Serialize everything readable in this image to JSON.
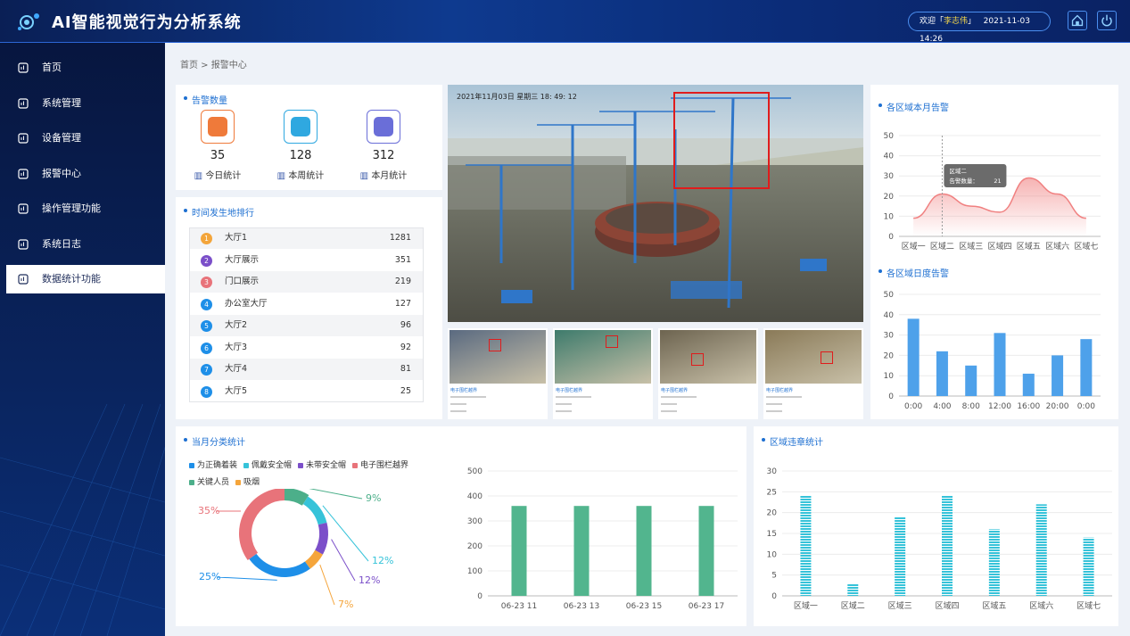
{
  "app": {
    "title": "AI智能视觉行为分析系统",
    "welcome_prefix": "欢迎「",
    "user": "李志伟",
    "welcome_suffix": "」",
    "datetime": "2021-11-03  14:26"
  },
  "nav": {
    "items": [
      {
        "label": "首页",
        "icon": "home-icon"
      },
      {
        "label": "系统管理",
        "icon": "gear-icon"
      },
      {
        "label": "设备管理",
        "icon": "org-icon"
      },
      {
        "label": "报警中心",
        "icon": "alarm-icon"
      },
      {
        "label": "操作管理功能",
        "icon": "cube-icon"
      },
      {
        "label": "系统日志",
        "icon": "log-icon"
      },
      {
        "label": "数据统计功能",
        "icon": "chart-icon"
      }
    ],
    "active_index": 6
  },
  "breadcrumb": "首页 > 报警中心",
  "alarm_count": {
    "title": "告警数量",
    "items": [
      {
        "value": "35",
        "label": "今日统计",
        "color": "#ef7a3a"
      },
      {
        "value": "128",
        "label": "本周统计",
        "color": "#2fa8e0"
      },
      {
        "value": "312",
        "label": "本月统计",
        "color": "#6a6ed8"
      }
    ]
  },
  "ranking": {
    "title": "时间发生地排行",
    "rows": [
      {
        "rank": "1",
        "name": "大厅1",
        "value": "1281",
        "color": "#f3a53b"
      },
      {
        "rank": "2",
        "name": "大厅展示",
        "value": "351",
        "color": "#7b4fc9"
      },
      {
        "rank": "3",
        "name": "门口展示",
        "value": "219",
        "color": "#e8737a"
      },
      {
        "rank": "4",
        "name": "办公室大厅",
        "value": "127",
        "color": "#1e8fe8"
      },
      {
        "rank": "5",
        "name": "大厅2",
        "value": "96",
        "color": "#1e8fe8"
      },
      {
        "rank": "6",
        "name": "大厅3",
        "value": "92",
        "color": "#1e8fe8"
      },
      {
        "rank": "7",
        "name": "大厅4",
        "value": "81",
        "color": "#1e8fe8"
      },
      {
        "rank": "8",
        "name": "大厅5",
        "value": "25",
        "color": "#1e8fe8"
      }
    ]
  },
  "camera": {
    "timestamp": "2021年11月03日   星期三   18: 49: 12"
  },
  "thumbs": [
    {
      "caption": "电子围栏越界"
    },
    {
      "caption": "电子围栏越界"
    },
    {
      "caption": "电子围栏越界"
    },
    {
      "caption": "电子围栏越界"
    }
  ],
  "monthly_region": {
    "title": "各区域本月告警",
    "tooltip_title": "区域二",
    "tooltip_label": "告警数量：",
    "tooltip_value": "21"
  },
  "daily_region": {
    "title": "各区域日度告警"
  },
  "category": {
    "title": "当月分类统计",
    "legend": [
      {
        "label": "为正确着装",
        "color": "#1e8fe8"
      },
      {
        "label": "佩戴安全帽",
        "color": "#36c3d9"
      },
      {
        "label": "未带安全帽",
        "color": "#7b4fc9"
      },
      {
        "label": "电子围栏越界",
        "color": "#e8737a"
      },
      {
        "label": "关键人员",
        "color": "#4caf8a"
      },
      {
        "label": "吸烟",
        "color": "#f5a53b"
      }
    ]
  },
  "violation": {
    "title": "区域违章统计"
  },
  "chart_data": [
    {
      "type": "area",
      "categories": [
        "区域一",
        "区域二",
        "区域三",
        "区域四",
        "区域五",
        "区域六",
        "区域七"
      ],
      "values": [
        9,
        21,
        15,
        12,
        29,
        21,
        9
      ],
      "ylim": [
        0,
        50
      ],
      "yticks": [
        0,
        10,
        20,
        30,
        40,
        50
      ],
      "color": "#f08080",
      "grid": true
    },
    {
      "type": "bar",
      "categories": [
        "0:00",
        "4:00",
        "8:00",
        "12:00",
        "16:00",
        "20:00",
        "0:00"
      ],
      "values": [
        38,
        22,
        15,
        31,
        11,
        20,
        28
      ],
      "ylim": [
        0,
        50
      ],
      "yticks": [
        0,
        10,
        20,
        30,
        40,
        50
      ],
      "color": "#4ea1ea",
      "grid": true
    },
    {
      "type": "pie",
      "categories": [
        "关键人员",
        "佩戴安全帽",
        "未带安全帽",
        "吸烟",
        "为正确着装",
        "电子围栏越界"
      ],
      "values": [
        9,
        12,
        12,
        7,
        25,
        35
      ],
      "labels": [
        "9%",
        "12%",
        "12%",
        "7%",
        "25%",
        "35%"
      ],
      "colors": [
        "#4caf8a",
        "#36c3d9",
        "#7b4fc9",
        "#f5a53b",
        "#1e8fe8",
        "#e8737a"
      ]
    },
    {
      "type": "bar",
      "categories": [
        "06-23 11",
        "06-23 13",
        "06-23 15",
        "06-23 17"
      ],
      "values": [
        360,
        360,
        360,
        360
      ],
      "ylim": [
        0,
        500
      ],
      "yticks": [
        0,
        100,
        200,
        300,
        400,
        500
      ],
      "color": "#52b58e",
      "grid": true
    },
    {
      "type": "bar",
      "categories": [
        "区域一",
        "区域二",
        "区域三",
        "区域四",
        "区域五",
        "区域六",
        "区域七"
      ],
      "values": [
        24,
        3,
        19,
        24,
        16,
        22,
        14
      ],
      "ylim": [
        0,
        30
      ],
      "yticks": [
        0,
        5,
        10,
        15,
        20,
        25,
        30
      ],
      "color": "#36c3d9",
      "grid": true
    }
  ]
}
